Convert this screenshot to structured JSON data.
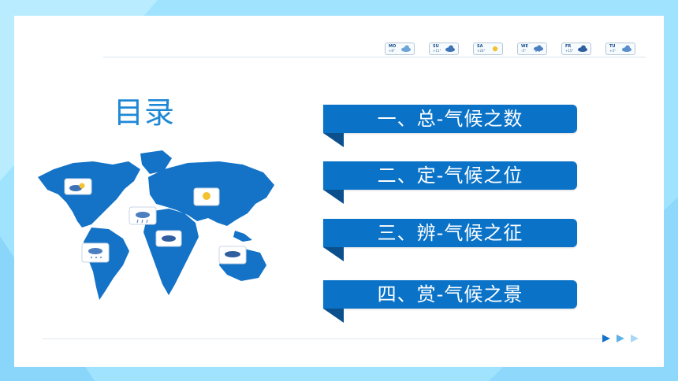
{
  "title": "目录",
  "menu": [
    {
      "label": "一、总-气候之数"
    },
    {
      "label": "二、定-气候之位"
    },
    {
      "label": "三、辨-气候之征"
    },
    {
      "label": "四、赏-气候之景"
    }
  ],
  "weather_chips": [
    {
      "day": "MO",
      "temp": "+8°",
      "icon": "cloud-icon"
    },
    {
      "day": "SU",
      "temp": "+11°",
      "icon": "cloud-icon"
    },
    {
      "day": "SA",
      "temp": "+26°",
      "icon": "sun-icon"
    },
    {
      "day": "WE",
      "temp": "-5°",
      "icon": "snow-cloud-icon"
    },
    {
      "day": "FR",
      "temp": "+15°",
      "icon": "cloud-icon"
    },
    {
      "day": "TU",
      "temp": "+3°",
      "icon": "cloud-icon"
    }
  ],
  "colors": {
    "accent": "#0a73c8",
    "accent_dark": "#0b4f8c",
    "title": "#1e88d6",
    "background": "#9fe3ff",
    "map": "#1473c6"
  }
}
